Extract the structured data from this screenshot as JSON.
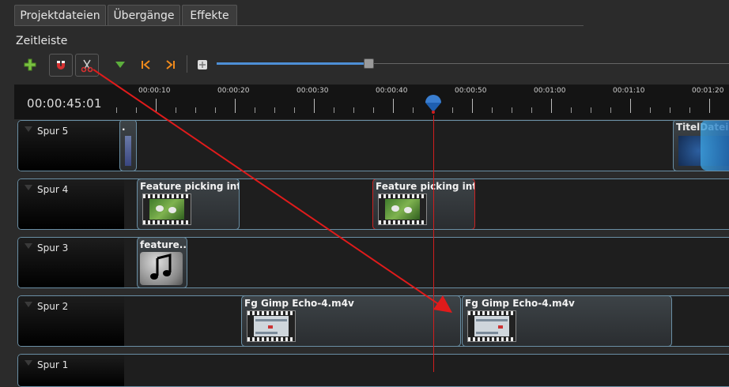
{
  "tabs": [
    {
      "label": "Projektdateien"
    },
    {
      "label": "Übergänge"
    },
    {
      "label": "Effekte"
    }
  ],
  "section_title": "Zeitleiste",
  "toolbar": {
    "add": "plus-icon",
    "snap": "magnet-icon",
    "razor": "scissors-icon",
    "marker": "marker-icon",
    "prev_marker": "jump-start-icon",
    "next_marker": "jump-end-icon",
    "zoom_fit": "center-icon"
  },
  "zoom_level": 0.3,
  "timeline": {
    "current_time": "00:00:45:01",
    "ticks": [
      "00:00:10",
      "00:00:20",
      "00:00:30",
      "00:00:40",
      "00:00:50",
      "00:01:00",
      "00:01:10",
      "00:01:20"
    ]
  },
  "tracks": [
    {
      "label": "Spur 5"
    },
    {
      "label": "Spur 4"
    },
    {
      "label": "Spur 3"
    },
    {
      "label": "Spur 2"
    },
    {
      "label": "Spur 1"
    }
  ],
  "clips": {
    "track5_right": "TitelDateiNa",
    "track4_a": "Feature picking intr...",
    "track4_b": "Feature picking intr...",
    "track3_a": "feature...",
    "track2_a": "Fg Gimp Echo-4.m4v",
    "track2_b": "Fg Gimp Echo-4.m4v"
  },
  "colors": {
    "accent": "#4d8fd6",
    "playhead": "#d01e1e",
    "track_border": "#6a8fa5",
    "add_green": "#7ac142",
    "nav_orange": "#f08a1c"
  }
}
